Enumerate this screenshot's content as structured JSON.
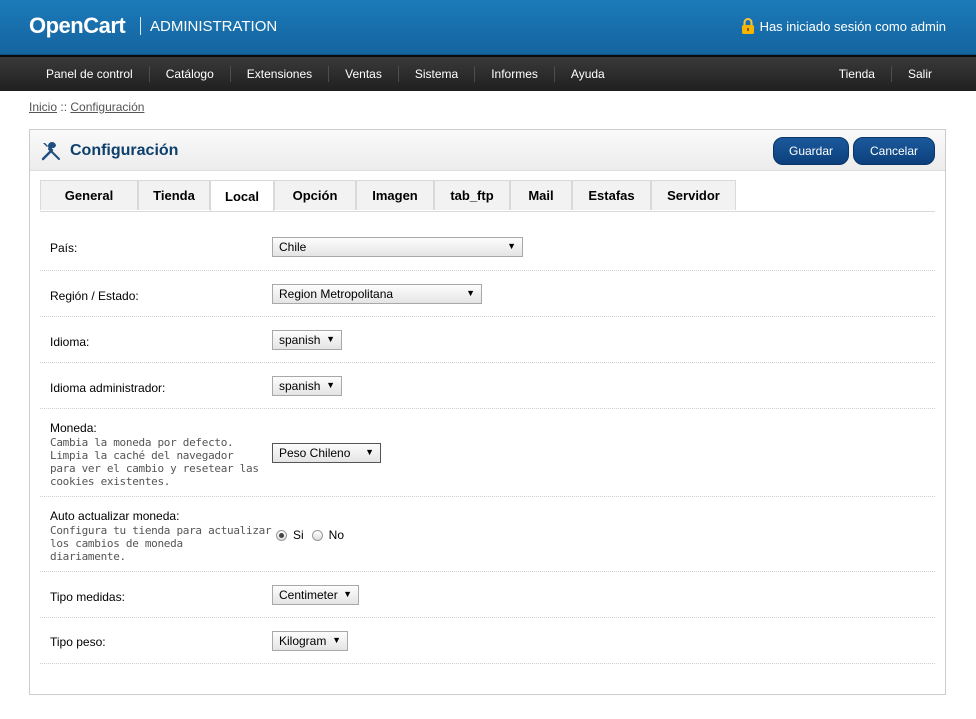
{
  "header": {
    "logo": "OpenCart",
    "subtitle": "ADMINISTRATION",
    "login_text": "Has iniciado sesión como admin"
  },
  "menu": {
    "left": [
      "Panel de control",
      "Catálogo",
      "Extensiones",
      "Ventas",
      "Sistema",
      "Informes",
      "Ayuda"
    ],
    "right": [
      "Tienda",
      "Salir"
    ]
  },
  "breadcrumb": {
    "home": "Inicio",
    "separator": "::",
    "current": "Configuración"
  },
  "panel": {
    "title": "Configuración",
    "save_label": "Guardar",
    "cancel_label": "Cancelar"
  },
  "tabs": [
    "General",
    "Tienda",
    "Local",
    "Opción",
    "Imagen",
    "tab_ftp",
    "Mail",
    "Estafas",
    "Servidor"
  ],
  "active_tab": "Local",
  "form": {
    "country": {
      "label": "País:",
      "value": "Chile"
    },
    "region": {
      "label": "Región / Estado:",
      "value": "Region Metropolitana"
    },
    "language": {
      "label": "Idioma:",
      "value": "spanish"
    },
    "admin_language": {
      "label": "Idioma administrador:",
      "value": "spanish"
    },
    "currency": {
      "label": "Moneda:",
      "help": [
        "Cambia la moneda por defecto.",
        "Limpia la caché del navegador",
        "para ver el cambio y resetear las",
        "cookies existentes."
      ],
      "value": "Peso Chileno"
    },
    "auto_currency": {
      "label": "Auto actualizar moneda:",
      "help": [
        "Configura tu tienda para actualizar",
        "los cambios de moneda",
        "diariamente."
      ],
      "option_yes": "Si",
      "option_no": "No",
      "selected": "Si"
    },
    "length_class": {
      "label": "Tipo medidas:",
      "value": "Centimeter"
    },
    "weight_class": {
      "label": "Tipo peso:",
      "value": "Kilogram"
    }
  },
  "colors": {
    "header": "#1a74b2",
    "menubar": "#2b2b2b",
    "button": "#144f8f",
    "title": "#0d3f6d"
  }
}
